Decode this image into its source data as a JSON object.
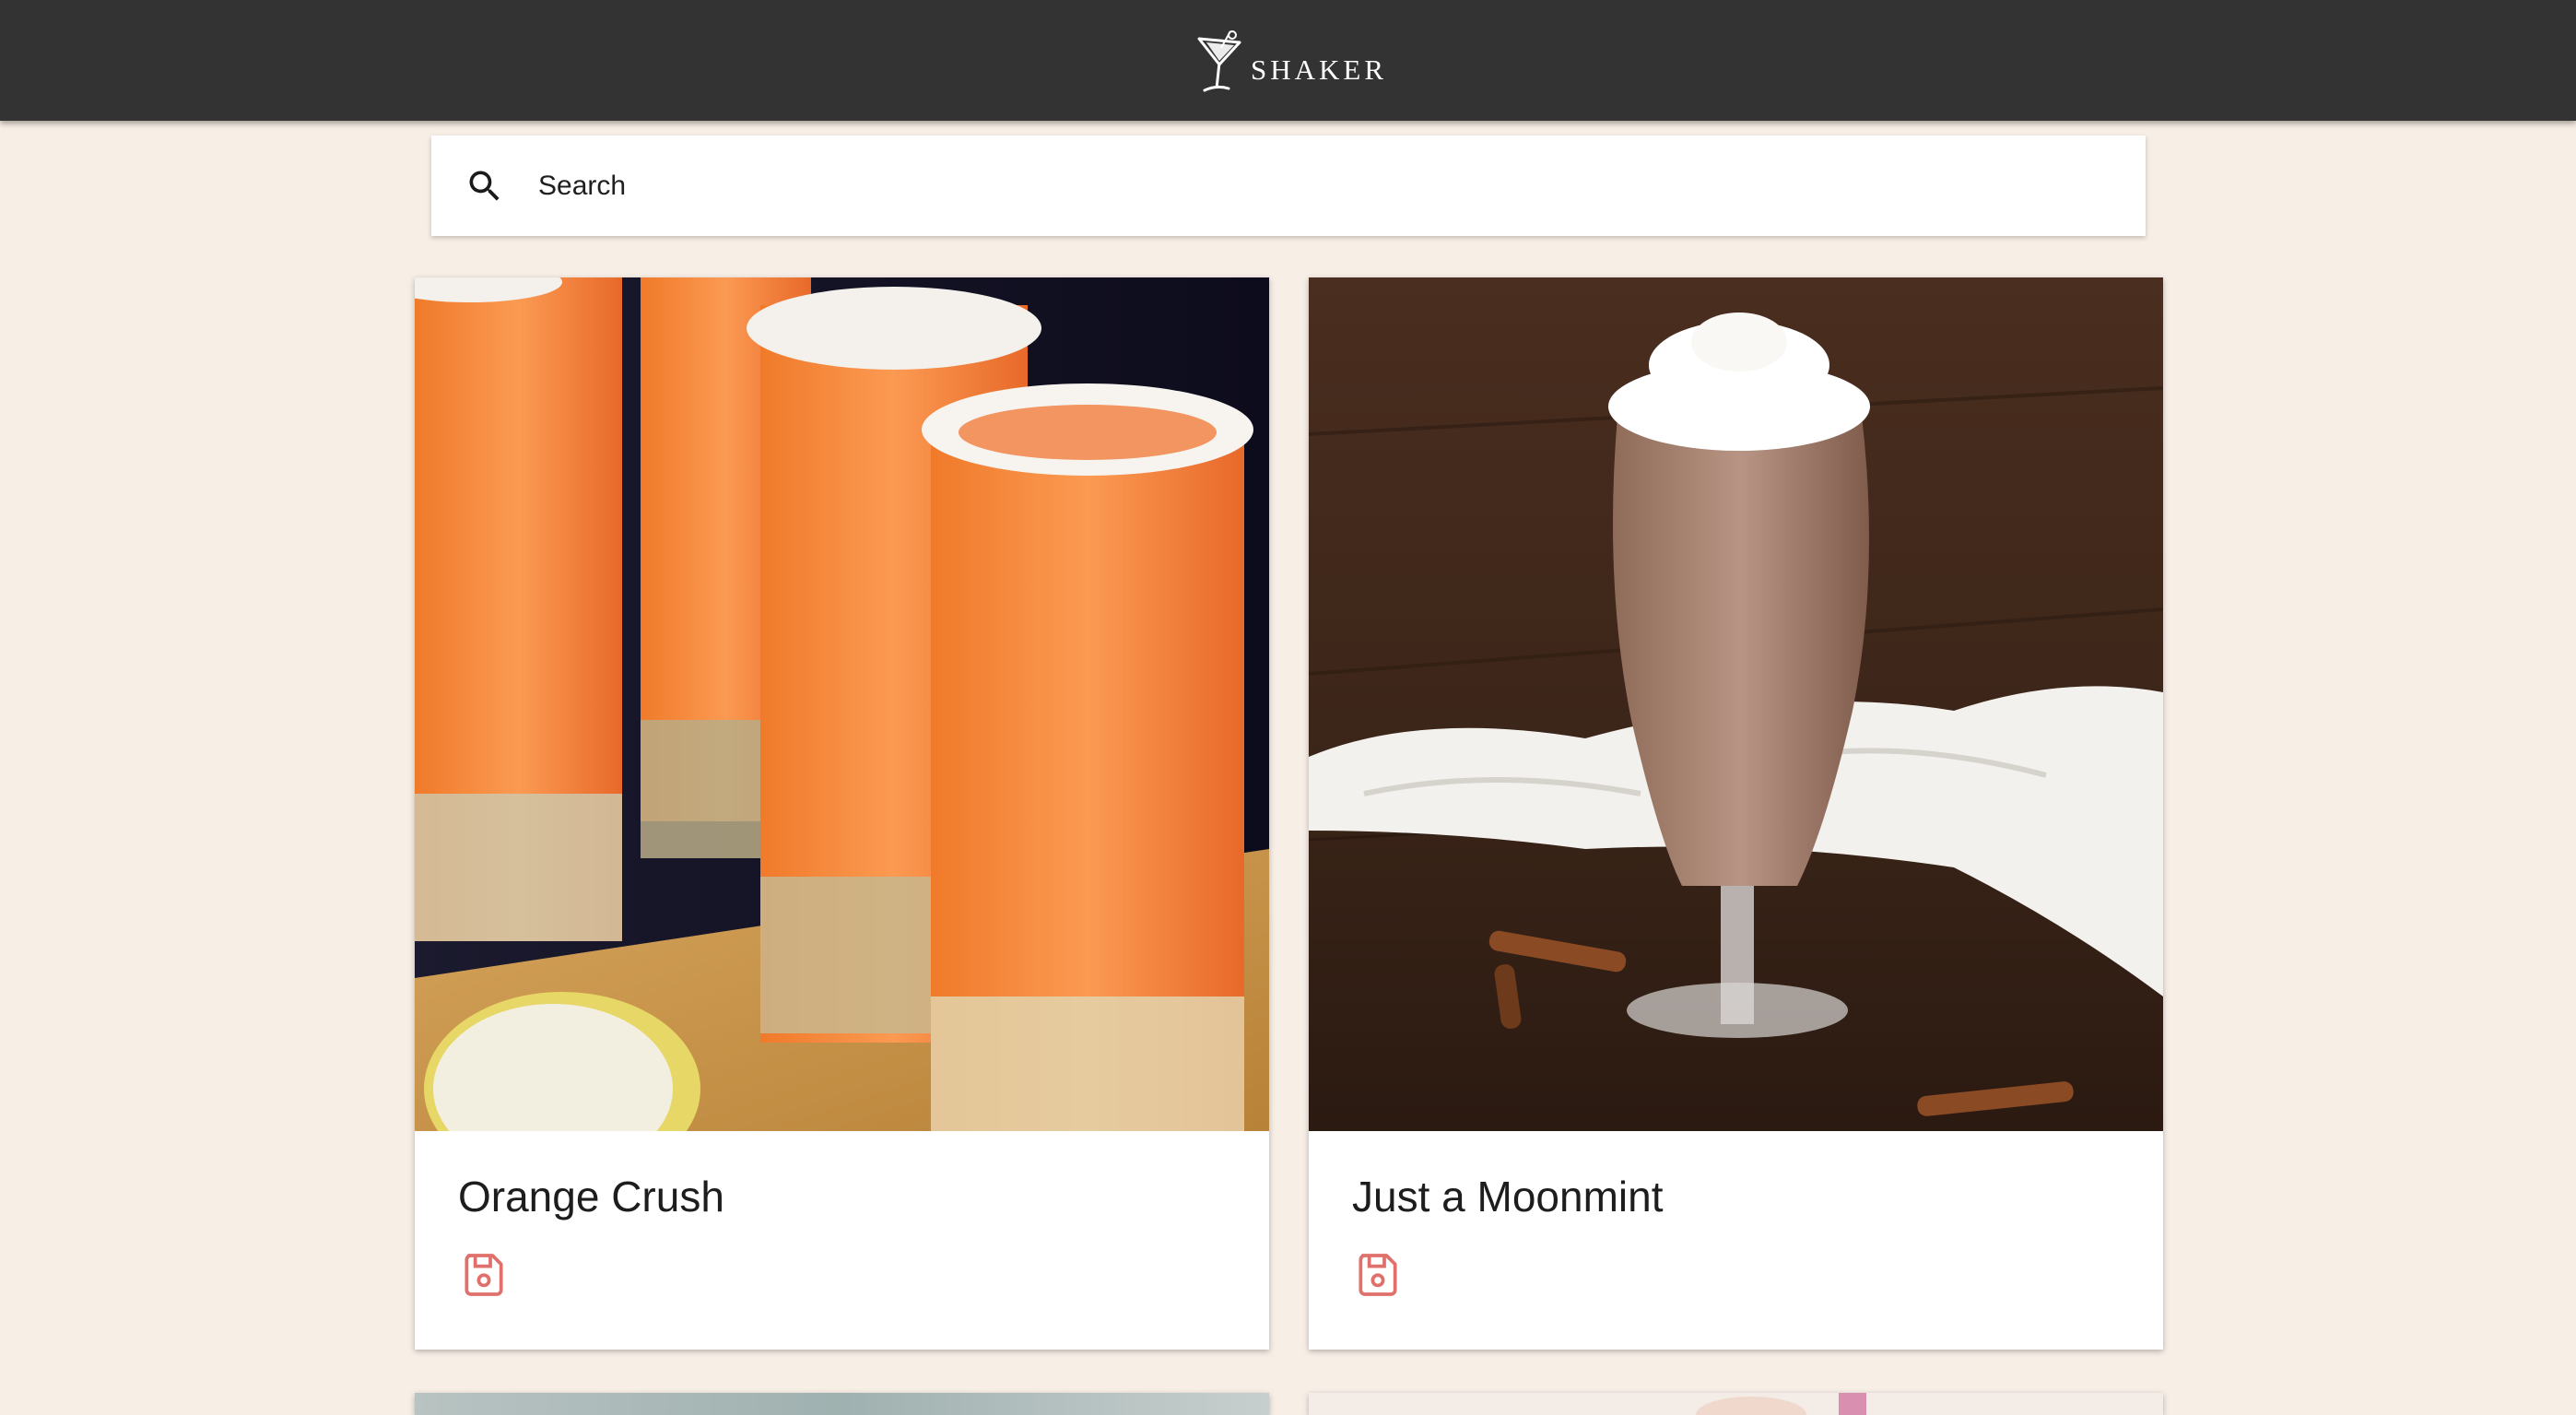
{
  "header": {
    "brand_name": "SHAKER",
    "logo_icon": "martini-glass-icon"
  },
  "search": {
    "placeholder": "Search",
    "value": "",
    "icon": "search-icon"
  },
  "colors": {
    "header_bg": "#333333",
    "page_bg": "#f7efe6",
    "save_icon": "#e0706c"
  },
  "cards": [
    {
      "title": "Orange Crush",
      "save_icon": "floppy-disk-icon"
    },
    {
      "title": "Just a Moonmint",
      "save_icon": "floppy-disk-icon"
    },
    {
      "title": "",
      "save_icon": ""
    },
    {
      "title": "",
      "save_icon": ""
    }
  ]
}
